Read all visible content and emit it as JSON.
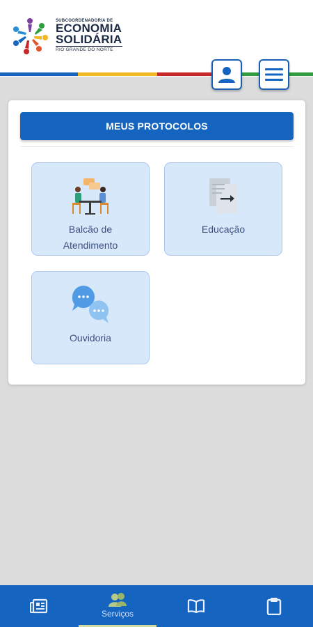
{
  "header": {
    "logo": {
      "line_small": "SUBCOORDENADORIA DE",
      "line1": "ECONOMIA",
      "line2": "SOLIDÁRIA",
      "line_sub": "RIO GRANDE DO NORTE"
    },
    "stripe_colors": [
      "#1565c0",
      "#f2b722",
      "#c62828",
      "#2e9e3e"
    ],
    "buttons": [
      {
        "name": "profile",
        "icon": "user-icon"
      },
      {
        "name": "menu",
        "icon": "hamburger-icon"
      }
    ]
  },
  "main": {
    "protocols_button": "MEUS PROTOCOLOS",
    "tiles": [
      {
        "label_line1": "Balcão de",
        "label_line2": "Atendimento",
        "icon": "service-desk-icon"
      },
      {
        "label_line1": "Educação",
        "label_line2": "",
        "icon": "document-transfer-icon"
      },
      {
        "label_line1": "Ouvidoria",
        "label_line2": "",
        "icon": "chat-bubbles-icon"
      }
    ]
  },
  "bottom_nav": {
    "items": [
      {
        "label": "",
        "icon": "news-icon",
        "active": false
      },
      {
        "label": "Serviços",
        "icon": "people-icon",
        "active": true
      },
      {
        "label": "",
        "icon": "book-icon",
        "active": false
      },
      {
        "label": "",
        "icon": "clipboard-icon",
        "active": false
      }
    ]
  },
  "colors": {
    "primary": "#1565c0",
    "tile_bg": "#d8e8fb",
    "tile_border": "#a9c7ee",
    "tile_text": "#3a4f80",
    "page_bg": "#dcdcdc"
  }
}
